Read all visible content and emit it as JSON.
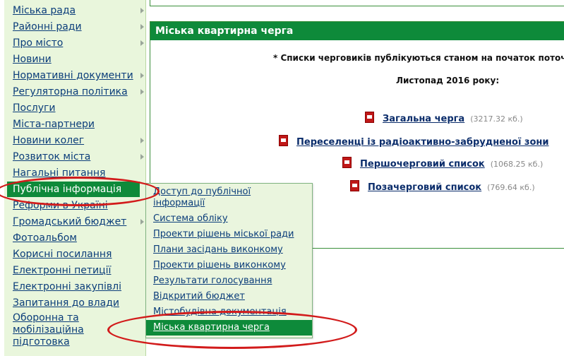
{
  "sidebar": {
    "items": [
      {
        "label": "Міська рада",
        "arrow": true
      },
      {
        "label": "Районні ради",
        "arrow": true
      },
      {
        "label": "Про місто",
        "arrow": true
      },
      {
        "label": "Новини",
        "arrow": false
      },
      {
        "label": "Нормативні документи",
        "arrow": true
      },
      {
        "label": "Регуляторна політика",
        "arrow": true
      },
      {
        "label": "Послуги",
        "arrow": false
      },
      {
        "label": "Міста-партнери",
        "arrow": false
      },
      {
        "label": "Новини колег",
        "arrow": true
      },
      {
        "label": "Розвиток міста",
        "arrow": true
      },
      {
        "label": "Нагальні питання",
        "arrow": false
      },
      {
        "label": "Публічна інформація",
        "arrow": false,
        "active": true
      },
      {
        "label": "Реформи в Україні",
        "arrow": false
      },
      {
        "label": "Громадський бюджет",
        "arrow": true
      },
      {
        "label": "Фотоальбом",
        "arrow": false
      },
      {
        "label": "Корисні посилання",
        "arrow": false
      },
      {
        "label": "Електронні петиції",
        "arrow": false
      },
      {
        "label": "Електронні закупівлі",
        "arrow": false
      },
      {
        "label": "Запитання до влади",
        "arrow": false
      },
      {
        "label": "Оборонна та мобілізаційна підготовка",
        "arrow": false
      }
    ]
  },
  "submenu": {
    "items": [
      "Доступ до публічної інформації",
      "Система обліку",
      "Проекти рішень міської ради",
      "Плани засідань виконкому",
      "Проекти рішень виконкому",
      "Результати голосування",
      "Відкритий бюджет",
      "Містобудівна документація",
      "Міська квартирна черга"
    ],
    "active_index": 8
  },
  "panel": {
    "title": "Міська квартирна черга",
    "notice": "* Списки черговиків публікуються станом на початок поточ",
    "period": "Листопад 2016 року:",
    "documents": [
      {
        "title": "Загальна черга",
        "size": "(3217.32 кб.)"
      },
      {
        "title": "Переселенці із радіоактивно-забрудненої зони",
        "size": ""
      },
      {
        "title": "Першочерговий список",
        "size": "(1068.25 кб.)"
      },
      {
        "title": "Позачерговий список",
        "size": "(769.64 кб.)"
      }
    ]
  },
  "colors": {
    "accent_green": "#0e8a3a",
    "sidebar_bg": "#e9f6dc",
    "link_blue": "#0b2d6b",
    "annotation_red": "#d21b1b"
  }
}
